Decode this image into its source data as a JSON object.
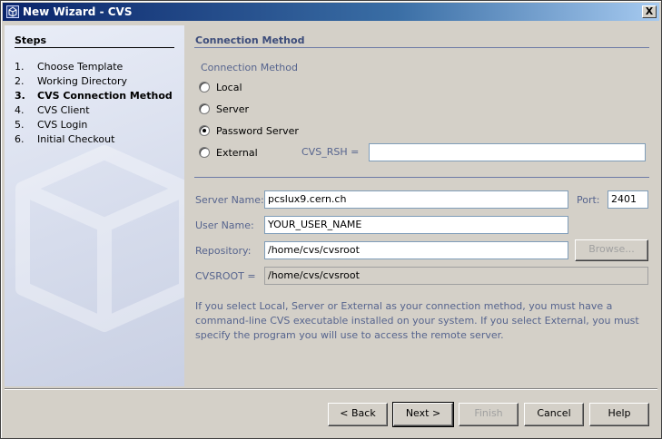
{
  "window": {
    "title": "New Wizard - CVS",
    "close_glyph": "X"
  },
  "steps": {
    "title": "Steps",
    "items": [
      {
        "num": "1.",
        "label": "Choose Template"
      },
      {
        "num": "2.",
        "label": "Working Directory"
      },
      {
        "num": "3.",
        "label": "CVS Connection Method"
      },
      {
        "num": "4.",
        "label": "CVS Client"
      },
      {
        "num": "5.",
        "label": "CVS Login"
      },
      {
        "num": "6.",
        "label": "Initial Checkout"
      }
    ]
  },
  "connection": {
    "section_title": "Connection Method",
    "group_label": "Connection Method",
    "options": [
      {
        "label": "Local",
        "selected": false
      },
      {
        "label": "Server",
        "selected": false
      },
      {
        "label": "Password Server",
        "selected": true
      },
      {
        "label": "External",
        "selected": false
      }
    ],
    "cvs_rsh_label": "CVS_RSH =",
    "cvs_rsh_value": ""
  },
  "form": {
    "server_name_label": "Server Name:",
    "server_name_value": "pcslux9.cern.ch",
    "port_label": "Port:",
    "port_value": "2401",
    "user_name_label": "User Name:",
    "user_name_value": "YOUR_USER_NAME",
    "repository_label": "Repository:",
    "repository_value": "/home/cvs/cvsroot",
    "browse_label": "Browse...",
    "cvsroot_label": "CVSROOT =",
    "cvsroot_value": "/home/cvs/cvsroot"
  },
  "info": "If you select Local, Server or External as your connection method, you must have a command-line CVS executable installed on your system. If you select External, you must specify the program you will use to access the remote server.",
  "buttons": {
    "back": "< Back",
    "next": "Next >",
    "finish": "Finish",
    "cancel": "Cancel",
    "help": "Help"
  },
  "colors": {
    "title_bar": "#0a246a",
    "left_panel": "#d6dcec",
    "accent_text": "#56648e",
    "section_title": "#3c4c7a"
  }
}
